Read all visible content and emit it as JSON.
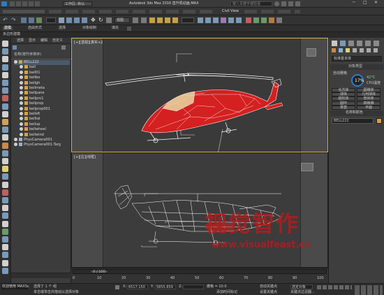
{
  "titlebar": {
    "workspace": "工作区: 默认",
    "title": "Autodesk 3ds Max 2016    直升机动画.MAX",
    "search_placeholder": "键入关键字或短语"
  },
  "menubar": {
    "items": [
      "Civil View"
    ]
  },
  "toolbar": {
    "dropdown": "视图"
  },
  "ribbon": {
    "tabs": [
      "建模",
      "自由形式",
      "选择",
      "对象绘制",
      "填充"
    ],
    "subtitle": "多边形建模"
  },
  "scene_explorer": {
    "tabs": [
      "选择",
      "显示",
      "编辑",
      "自定义"
    ],
    "header": "名称(按升序排序)",
    "items": [
      "BELL222",
      "ball",
      "ball01",
      "bellbo",
      "bellgh",
      "bellmeta",
      "bellpane",
      "bellpro1",
      "bellprop",
      "bellprop001",
      "bellsft",
      "belltal",
      "bellup",
      "bellwheel",
      "bellwind",
      "PhysCamera001",
      "PhysCamera001.Targ"
    ]
  },
  "viewports": {
    "top_label": "[+][透视][真实+边面]",
    "bottom_label": "[+][左][线框]"
  },
  "right_panel": {
    "dropdown": "标准基本体",
    "section_type": "对象类型",
    "auto_grid": "自动栅格",
    "buttons": [
      "长方体",
      "圆锥体",
      "球体",
      "几何球体",
      "圆柱体",
      "管状体",
      "圆环",
      "四棱锥",
      "茶壶",
      "平面"
    ],
    "section_name": "名称和颜色",
    "name_value": "BELL222",
    "cpu_percent": "17%",
    "temp": "42°C",
    "cpu_label": "CPU温度"
  },
  "timeline": {
    "frame": "0 / 100",
    "ticks": [
      "0",
      "10",
      "20",
      "30",
      "40",
      "50",
      "60",
      "70",
      "80",
      "90",
      "100"
    ]
  },
  "statusbar": {
    "welcome": "欢迎使用 MAXSc",
    "selected": "选择了 1 个 组",
    "prompt": "单击或单击并拖动以选择对象",
    "x_label": "X:",
    "x_value": "6517.150",
    "y_label": "Y:",
    "y_value": "5855.859",
    "z_label": "Z:",
    "grid": "栅格 = 10.0",
    "add_time_tag": "添加时间标记",
    "auto_key": "自动关键点",
    "set_key": "设置关键点",
    "selected_obj": "选定对象",
    "key_filter": "关键点过滤器..."
  },
  "watermark": {
    "cn": "视觉智作",
    "url": "www.visualfeast.cn"
  },
  "colors": {
    "heli_body": "#d42020",
    "wire": "#ffffff",
    "active_border": "#d4b24a",
    "accent_blue": "#2e7bc4"
  }
}
